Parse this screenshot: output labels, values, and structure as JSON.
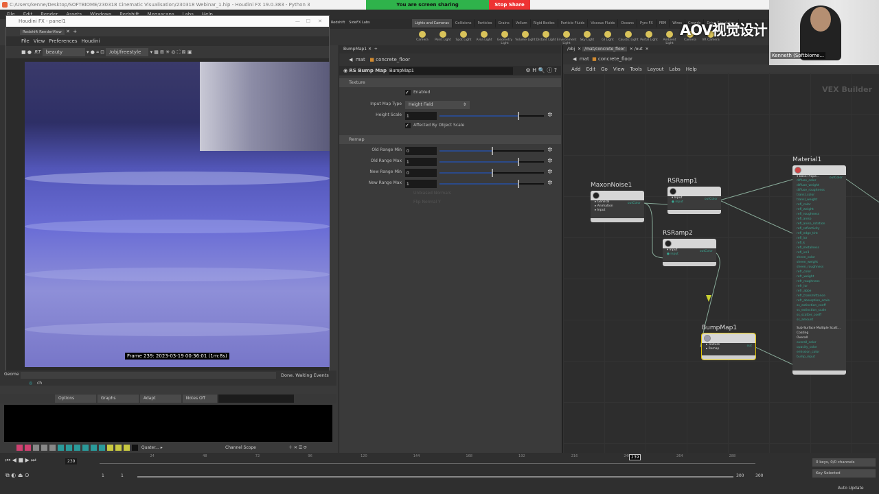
{
  "window": {
    "title": "C:/Users/kenne/Desktop/SOFTBIOME/230318 Cinematic Visualisation/230318 Webinar_1.hip - Houdini FX 19.0.383 - Python 3"
  },
  "share": {
    "text": "You are screen sharing",
    "stop": "Stop Share"
  },
  "menubar": [
    "File",
    "Edit",
    "Render",
    "Assets",
    "Windows",
    "Redshift",
    "Megascans",
    "Labs",
    "Help"
  ],
  "shelf": {
    "left_tabs": [
      "Redshift",
      "SideFX Labs"
    ],
    "tabs": [
      "Lights and Cameras",
      "Collisions",
      "Particles",
      "Grains",
      "Vellum",
      "Rigid Bodies",
      "Particle Fluids",
      "Viscous Fluids",
      "Oceans",
      "Pyro FX",
      "FEM",
      "Wires",
      "Crowds",
      "Drive Simulation"
    ],
    "tools": [
      "Camera",
      "Point Light",
      "Spot Light",
      "Area Light",
      "Geometry Light",
      "Volume Light",
      "Distant Light",
      "Environment Light",
      "Sky Light",
      "GI Light",
      "Caustic Light",
      "Portal Light",
      "Ambient Light",
      "Camera",
      "VR Camera"
    ]
  },
  "webcam": {
    "name": "Kenneth (Softbiome...",
    "watermark": "AOV视觉设计"
  },
  "floating": {
    "title": "Houdini FX - panel1",
    "tab": "Redshift RenderView",
    "menu": [
      "File",
      "View",
      "Preferences",
      "Houdini"
    ],
    "aov": "beauty",
    "camera": "/obj/freestyle",
    "rt": "RT",
    "frame_info": "Frame 239: 2023-03-19 00:36:01 (1m:8s)"
  },
  "status": {
    "left": "Geome",
    "text": "Done. Waiting Events",
    "cmd": "ch"
  },
  "params": {
    "tab": "BumpMap1",
    "path": [
      "mat",
      "concrete_floor"
    ],
    "node_type": "RS Bump Map",
    "node_name": "BumpMap1",
    "texture_section": "Texture",
    "enabled_label": "Enabled",
    "input_map_type_label": "Input Map Type",
    "input_map_type": "Height Field",
    "height_scale_label": "Height Scale",
    "height_scale": "1",
    "affected_label": "Affected By Object Scale",
    "remap_section": "Remap",
    "remap": [
      {
        "label": "Old Range Min",
        "value": "0",
        "fraction": 0.5
      },
      {
        "label": "Old Range Max",
        "value": "1",
        "fraction": 0.75
      },
      {
        "label": "New Range Min",
        "value": "0",
        "fraction": 0.5
      },
      {
        "label": "New Range Max",
        "value": "1",
        "fraction": 0.75
      }
    ],
    "height_scale_fraction": 0.75,
    "disabled": [
      "Unbiased Normals",
      "Flip Normal Y"
    ]
  },
  "network": {
    "tabs": [
      "/obj",
      "/mat/concrete_floor",
      "/out"
    ],
    "path": [
      "mat",
      "concrete_floor"
    ],
    "menu": [
      "Add",
      "Edit",
      "Go",
      "View",
      "Tools",
      "Layout",
      "Labs",
      "Help"
    ],
    "context": "VEX Builder",
    "nodes": {
      "noise": {
        "name": "MaxonNoise1",
        "ports": [
          "General",
          "Animation",
          "Input"
        ],
        "out": "outColor"
      },
      "ramp1": {
        "name": "RSRamp1",
        "ports": [
          "Input"
        ],
        "sub": "input",
        "out": "outColor"
      },
      "ramp2": {
        "name": "RSRamp2",
        "ports": [
          "Input"
        ],
        "sub": "input",
        "out": "outColor"
      },
      "bump": {
        "name": "BumpMap1",
        "ports": [
          "Texture",
          "Remap"
        ],
        "out": "out"
      },
      "material": {
        "name": "Material1",
        "group": "Base Prope...",
        "out": "outColor",
        "base_params": [
          "diffuse_color",
          "diffuse_weight",
          "diffuse_roughness",
          "transl_color",
          "transl_weight",
          "refl_color",
          "refl_weight",
          "refl_roughness",
          "refl_aniso",
          "refl_aniso_rotation",
          "refl_reflectivity",
          "refl_edge_tint",
          "refl_ior",
          "refl_k",
          "refl_metalness",
          "refl_ior3",
          "sheen_color",
          "sheen_weight",
          "sheen_roughness",
          "refr_color",
          "refr_weight",
          "refr_roughness",
          "refr_ior",
          "refr_abbe",
          "refr_transmittance",
          "refr_absorption_scale",
          "ss_extinction_coeff",
          "ss_extinction_scale",
          "ss_scatter_coeff",
          "ss_amount"
        ],
        "groups": [
          "Sub-Surface Multiple Scatt...",
          "Coating",
          "Overall"
        ],
        "overall_params": [
          "overall_color",
          "opacity_color",
          "emission_color",
          "bump_input"
        ]
      }
    }
  },
  "chan": {
    "options": "Options",
    "graphs": "Graphs",
    "adapt": "Adapt",
    "notes": "Notes Off",
    "quater": "Quater...",
    "scope": "Channel Scope"
  },
  "timeline": {
    "frame": "239",
    "ticks": [
      "24",
      "48",
      "72",
      "96",
      "120",
      "144",
      "168",
      "192",
      "216",
      "240",
      "264",
      "288"
    ],
    "start": "1",
    "start2": "1",
    "end": "300",
    "end2": "300",
    "keys": "0 keys, 0/0 channels",
    "key_selected": "Key Selected",
    "auto_update": "Auto Update"
  },
  "colors": {
    "share": "#2fb34b",
    "stop": "#ee3333",
    "node_select": "#e3c400",
    "port": "#3aa893"
  }
}
